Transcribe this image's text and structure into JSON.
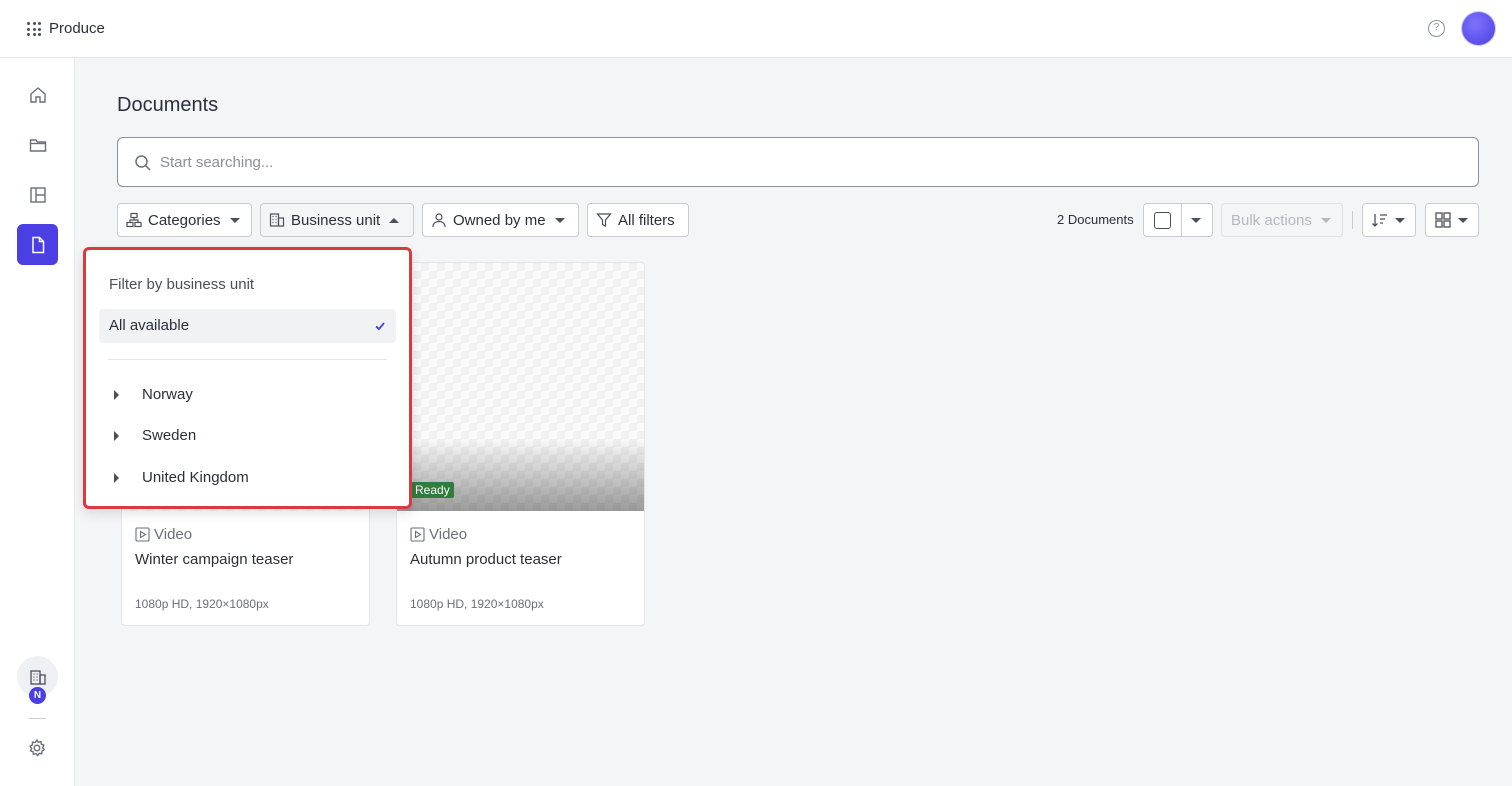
{
  "app": {
    "title": "Produce"
  },
  "header": {
    "help_icon": "help-circle-icon"
  },
  "sidebar": {
    "items": [
      {
        "name": "home",
        "icon": "home-icon"
      },
      {
        "name": "folders",
        "icon": "folder-icon"
      },
      {
        "name": "templates",
        "icon": "layout-icon"
      },
      {
        "name": "documents",
        "icon": "document-icon",
        "active": true
      }
    ],
    "business_unit_badge": "N"
  },
  "page": {
    "title": "Documents"
  },
  "search": {
    "placeholder": "Start searching..."
  },
  "filters": {
    "categories_label": "Categories",
    "business_unit_label": "Business unit",
    "owned_label": "Owned by me",
    "all_filters_label": "All filters"
  },
  "toolbar": {
    "count_label": "2 Documents",
    "bulk_actions_label": "Bulk actions"
  },
  "dropdown": {
    "title": "Filter by business unit",
    "all_label": "All available",
    "items": [
      "Norway",
      "Sweden",
      "United Kingdom"
    ]
  },
  "cards": [
    {
      "type": "Video",
      "name": "Winter campaign teaser",
      "meta": "1080p HD, 1920×1080px"
    },
    {
      "type": "Video",
      "name": "Autumn product teaser",
      "meta": "1080p HD, 1920×1080px",
      "status": "Ready"
    }
  ],
  "colors": {
    "accent": "#4b3fe4",
    "highlight": "#d93a40",
    "status_ready": "#2f7d3d"
  }
}
